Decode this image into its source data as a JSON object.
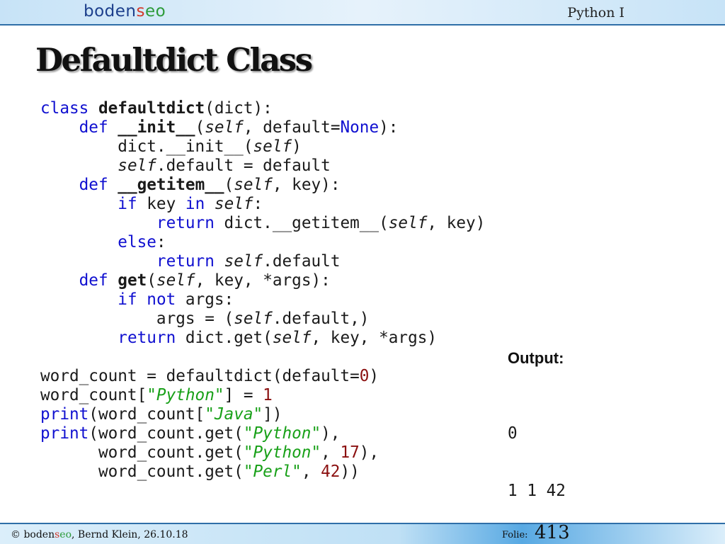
{
  "header": {
    "logo": {
      "part1": "boden",
      "part2": "s",
      "part3": "eo"
    },
    "course": "Python I"
  },
  "title": "Defaultdict Class",
  "code_lines": [
    [
      {
        "t": "class",
        "c": "kw"
      },
      {
        "t": " "
      },
      {
        "t": "defaultdict",
        "c": "bo"
      },
      {
        "t": "(dict):"
      }
    ],
    [
      {
        "t": "    "
      },
      {
        "t": "def",
        "c": "kw"
      },
      {
        "t": " "
      },
      {
        "t": "__init__",
        "c": "bo"
      },
      {
        "t": "("
      },
      {
        "t": "self",
        "c": "it"
      },
      {
        "t": ", default="
      },
      {
        "t": "None",
        "c": "kw"
      },
      {
        "t": "):"
      }
    ],
    [
      {
        "t": "        dict.__init__("
      },
      {
        "t": "self",
        "c": "it"
      },
      {
        "t": ")"
      }
    ],
    [
      {
        "t": "        "
      },
      {
        "t": "self",
        "c": "it"
      },
      {
        "t": ".default = default"
      }
    ],
    [
      {
        "t": "    "
      },
      {
        "t": "def",
        "c": "kw"
      },
      {
        "t": " "
      },
      {
        "t": "__getitem__",
        "c": "bo"
      },
      {
        "t": "("
      },
      {
        "t": "self",
        "c": "it"
      },
      {
        "t": ", key):"
      }
    ],
    [
      {
        "t": "        "
      },
      {
        "t": "if",
        "c": "kw"
      },
      {
        "t": " key "
      },
      {
        "t": "in",
        "c": "kw"
      },
      {
        "t": " "
      },
      {
        "t": "self",
        "c": "it"
      },
      {
        "t": ":"
      }
    ],
    [
      {
        "t": "            "
      },
      {
        "t": "return",
        "c": "kw"
      },
      {
        "t": " dict.__getitem__("
      },
      {
        "t": "self",
        "c": "it"
      },
      {
        "t": ", key)"
      }
    ],
    [
      {
        "t": "        "
      },
      {
        "t": "else",
        "c": "kw"
      },
      {
        "t": ":"
      }
    ],
    [
      {
        "t": "            "
      },
      {
        "t": "return",
        "c": "kw"
      },
      {
        "t": " "
      },
      {
        "t": "self",
        "c": "it"
      },
      {
        "t": ".default"
      }
    ],
    [
      {
        "t": "    "
      },
      {
        "t": "def",
        "c": "kw"
      },
      {
        "t": " "
      },
      {
        "t": "get",
        "c": "bo"
      },
      {
        "t": "("
      },
      {
        "t": "self",
        "c": "it"
      },
      {
        "t": ", key, *args):"
      }
    ],
    [
      {
        "t": "        "
      },
      {
        "t": "if",
        "c": "kw"
      },
      {
        "t": " "
      },
      {
        "t": "not",
        "c": "kw"
      },
      {
        "t": " args:"
      }
    ],
    [
      {
        "t": "            args = ("
      },
      {
        "t": "self",
        "c": "it"
      },
      {
        "t": ".default,)"
      }
    ],
    [
      {
        "t": "        "
      },
      {
        "t": "return",
        "c": "kw"
      },
      {
        "t": " dict.get("
      },
      {
        "t": "self",
        "c": "it"
      },
      {
        "t": ", key, *args)"
      }
    ],
    [],
    [
      {
        "t": "word_count = defaultdict(default="
      },
      {
        "t": "0",
        "c": "nu"
      },
      {
        "t": ")"
      }
    ],
    [
      {
        "t": "word_count["
      },
      {
        "t": "\"Python\"",
        "c": "st"
      },
      {
        "t": "] = "
      },
      {
        "t": "1",
        "c": "nu"
      }
    ],
    [
      {
        "t": "print",
        "c": "kw"
      },
      {
        "t": "(word_count["
      },
      {
        "t": "\"Java\"",
        "c": "st"
      },
      {
        "t": "])"
      }
    ],
    [
      {
        "t": "print",
        "c": "kw"
      },
      {
        "t": "(word_count.get("
      },
      {
        "t": "\"Python\"",
        "c": "st"
      },
      {
        "t": "),"
      }
    ],
    [
      {
        "t": "      word_count.get("
      },
      {
        "t": "\"Python\"",
        "c": "st"
      },
      {
        "t": ", "
      },
      {
        "t": "17",
        "c": "nu"
      },
      {
        "t": "),"
      }
    ],
    [
      {
        "t": "      word_count.get("
      },
      {
        "t": "\"Perl\"",
        "c": "st"
      },
      {
        "t": ", "
      },
      {
        "t": "42",
        "c": "nu"
      },
      {
        "t": "))"
      }
    ]
  ],
  "output": {
    "label": "Output:",
    "lines": [
      "0",
      "1 1 42"
    ]
  },
  "footer": {
    "copyright_prefix": "© ",
    "brand1": "boden",
    "brand2": "s",
    "brand3": "eo",
    "copyright_suffix": ", Bernd Klein, 26.10.18",
    "folie_label": "Folie:",
    "slide_number": "413"
  }
}
